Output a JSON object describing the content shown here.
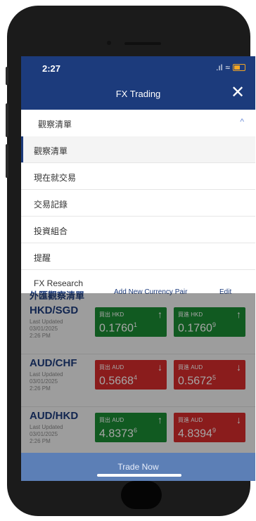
{
  "status_bar": {
    "time": "2:27",
    "signal": ".ıl",
    "wifi": "≈"
  },
  "app_bar": {
    "title": "FX Trading",
    "close_icon": "close-icon"
  },
  "dropdown": {
    "selected": "觀察清單",
    "chevron": "^"
  },
  "menu": [
    {
      "label": "觀察清單",
      "active": true
    },
    {
      "label": "現在就交易",
      "active": false
    },
    {
      "label": "交易記錄",
      "active": false
    },
    {
      "label": "投資組合",
      "active": false
    },
    {
      "label": "提醒",
      "active": false
    },
    {
      "label": "FX Research",
      "active": false
    }
  ],
  "background": {
    "header": "外匯觀察清單",
    "add_link": "Add New Currency Pair",
    "edit_link": "Edit",
    "pairs": [
      {
        "name": "HKD/SGD",
        "updated_label": "Last Updated",
        "date": "03/01/2025",
        "time": "2:26 PM",
        "buy": {
          "label": "買出 HKD",
          "price": "0.1760",
          "tail": "1",
          "trend": "up"
        },
        "sell": {
          "label": "買進 HKD",
          "price": "0.1760",
          "tail": "9",
          "trend": "up"
        }
      },
      {
        "name": "AUD/CHF",
        "updated_label": "Last Updated",
        "date": "03/01/2025",
        "time": "2:26 PM",
        "buy": {
          "label": "買出 AUD",
          "price": "0.5668",
          "tail": "4",
          "trend": "down"
        },
        "sell": {
          "label": "買進 AUD",
          "price": "0.5672",
          "tail": "5",
          "trend": "down"
        }
      },
      {
        "name": "AUD/HKD",
        "updated_label": "Last Updated",
        "date": "03/01/2025",
        "time": "2:26 PM",
        "buy": {
          "label": "買出 AUD",
          "price": "4.8373",
          "tail": "6",
          "trend": "up"
        },
        "sell": {
          "label": "買進 AUD",
          "price": "4.8394",
          "tail": "9",
          "trend": "down"
        }
      }
    ]
  },
  "trade_now": "Trade Now",
  "colors": {
    "primary": "#1c3b7c",
    "up": "#1b8a33",
    "down": "#d42b2b",
    "trade_bar": "#5c7fb6"
  }
}
